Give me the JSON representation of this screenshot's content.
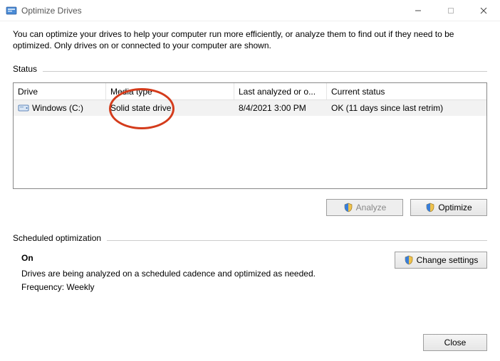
{
  "window": {
    "title": "Optimize Drives"
  },
  "intro": "You can optimize your drives to help your computer run more efficiently, or analyze them to find out if they need to be optimized. Only drives on or connected to your computer are shown.",
  "status": {
    "section_label": "Status",
    "columns": {
      "drive": "Drive",
      "media": "Media type",
      "last": "Last analyzed or o...",
      "status": "Current status"
    },
    "rows": [
      {
        "drive": "Windows (C:)",
        "media": "Solid state drive",
        "last": "8/4/2021 3:00 PM",
        "status": "OK (11 days since last retrim)"
      }
    ]
  },
  "buttons": {
    "analyze": "Analyze",
    "optimize": "Optimize",
    "change_settings": "Change settings",
    "close": "Close"
  },
  "scheduled": {
    "section_label": "Scheduled optimization",
    "state": "On",
    "desc": "Drives are being analyzed on a scheduled cadence and optimized as needed.",
    "frequency_label": "Frequency: Weekly"
  }
}
